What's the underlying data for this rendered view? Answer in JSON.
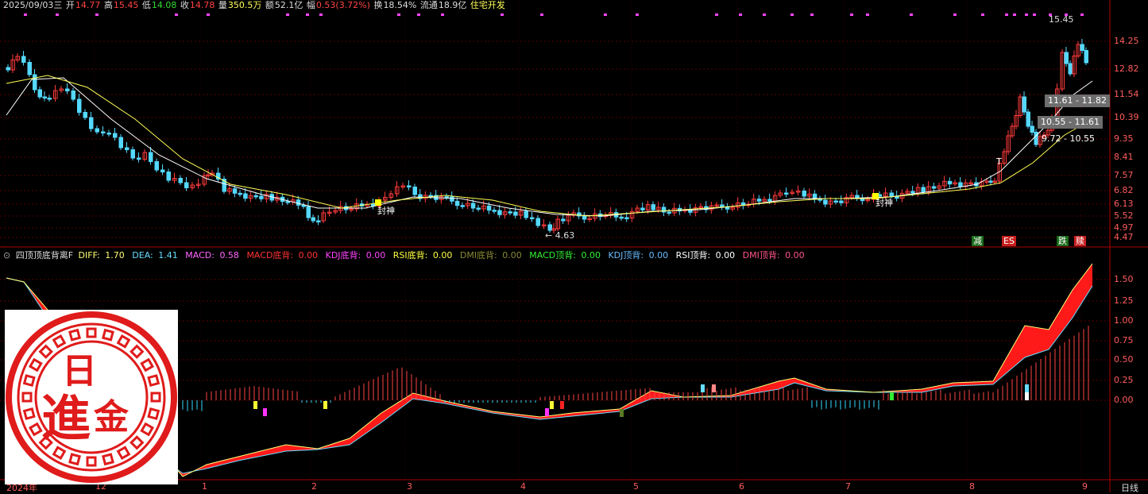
{
  "header": {
    "date": "2025/09/03三",
    "open_label": "开",
    "open_value": "14.77",
    "high_label": "高",
    "high_value": "15.45",
    "low_label": "低",
    "low_value": "14.08",
    "close_label": "收",
    "close_value": "14.78",
    "volume_label": "量",
    "volume_value": "350.5万",
    "amount_label": "额",
    "amount_value": "52.1亿",
    "change_label": "幅",
    "change_value": "0.53(3.72%)",
    "turnover_label": "换",
    "turnover_value": "18.54%",
    "float_label": "流通",
    "float_value": "18.9亿",
    "sector": "住宅开发"
  },
  "indicator": {
    "name": "四顶顶底背离F",
    "diff_label": "DIFF:",
    "diff_value": "1.70",
    "dea_label": "DEA:",
    "dea_value": "1.41",
    "macd_label": "MACD:",
    "macd_value": "0.58",
    "macd_bottom_label": "MACD底背:",
    "macd_bottom_value": "0.00",
    "kdj_bottom_label": "KDJ底背:",
    "kdj_bottom_value": "0.00",
    "rsi_bottom_label": "RSI底背:",
    "rsi_bottom_value": "0.00",
    "dmi_bottom_label": "DMI底背:",
    "dmi_bottom_value": "0.00",
    "macd_top_label": "MACD顶背:",
    "macd_top_value": "0.00",
    "kdj_top_label": "KDJ顶背:",
    "kdj_top_value": "0.00",
    "rsi_top_label": "RSI顶背:",
    "rsi_top_value": "0.00",
    "dmi_top_label": "DMI顶背:",
    "dmi_top_value": "0.00"
  },
  "price_axis": [
    "14.25",
    "12.82",
    "11.54",
    "10.39",
    "9.35",
    "8.41",
    "7.57",
    "6.82",
    "6.13",
    "5.52",
    "4.97",
    "4.47"
  ],
  "macd_axis": [
    "1.50",
    "1.25",
    "1.00",
    "0.75",
    "0.50",
    "0.25",
    "0.00"
  ],
  "time_axis": [
    "2024年",
    "12",
    "1",
    "2",
    "3",
    "4",
    "5",
    "6",
    "7",
    "8",
    "9"
  ],
  "period": "日线",
  "annotations": {
    "high_marker": "15.45",
    "low_marker": "4.63",
    "range_1": "11.61 - 11.82",
    "range_2": "10.55 - 11.61",
    "range_3": "9.72 - 10.55",
    "fengshen_1": "封神",
    "fengshen_2": "封神",
    "t_marker": "T",
    "badge_jian": "减",
    "badge_es": "ES",
    "badge_die": "跌",
    "badge_last": "赎"
  },
  "seal_text": [
    "日",
    "進",
    "金"
  ],
  "colors": {
    "up": "#ff3b3b",
    "down": "#54d8ff",
    "ma_white": "#ffffff",
    "ma_yellow": "#ffff55",
    "grid": "#5a0000",
    "axis_text": "#ff5c5c"
  }
}
